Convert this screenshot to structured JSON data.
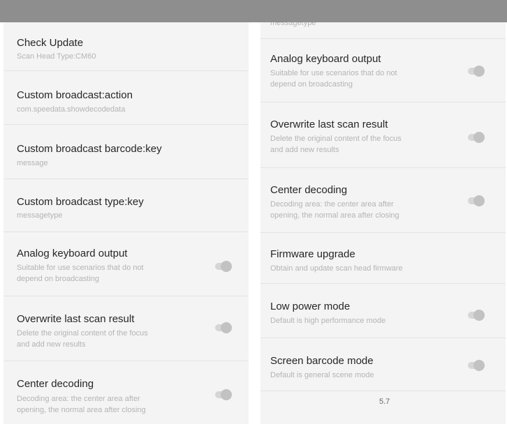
{
  "left": {
    "items": [
      {
        "title": "Check Update",
        "subtitle": "Scan Head Type:CM60"
      },
      {
        "title": "Custom broadcast:action",
        "subtitle": "com.speedata.showdecodedata"
      },
      {
        "title": "Custom broadcast barcode:key",
        "subtitle": "message"
      },
      {
        "title": "Custom broadcast type:key",
        "subtitle": "messagetype"
      },
      {
        "title": "Analog keyboard output",
        "subtitle_1": "Suitable for use scenarios that do not",
        "subtitle_2": "depend on broadcasting",
        "toggle_on": false
      },
      {
        "title": "Overwrite last scan result",
        "subtitle_1": "Delete the original content of the focus",
        "subtitle_2": "and add new results",
        "toggle_on": false
      },
      {
        "title": "Center decoding",
        "subtitle_1": "Decoding area: the center area after",
        "subtitle_2": "opening, the normal area after closing",
        "toggle_on": false
      }
    ]
  },
  "right": {
    "partial_top_subtitle": "messagetype",
    "items": [
      {
        "title": "Analog keyboard output",
        "subtitle_1": "Suitable for use scenarios that do not",
        "subtitle_2": "depend on broadcasting",
        "toggle_on": false
      },
      {
        "title": "Overwrite last scan result",
        "subtitle_1": "Delete the original content of the focus",
        "subtitle_2": "and add new results",
        "toggle_on": false
      },
      {
        "title": "Center decoding",
        "subtitle_1": "Decoding area: the center area after",
        "subtitle_2": "opening, the normal area after closing",
        "toggle_on": false
      },
      {
        "title": "Firmware upgrade",
        "subtitle": "Obtain and update scan head firmware"
      },
      {
        "title": "Low power mode",
        "subtitle": "Default is high performance mode",
        "toggle_on": false
      },
      {
        "title": "Screen barcode mode",
        "subtitle": "Default is general scene mode",
        "toggle_on": false
      }
    ],
    "version": "5.7"
  }
}
